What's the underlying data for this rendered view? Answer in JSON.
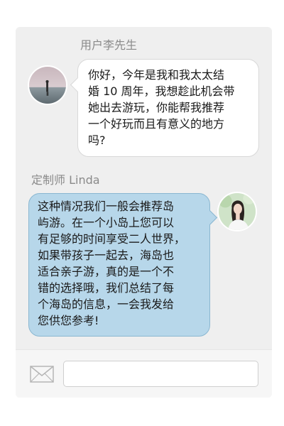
{
  "conversation": {
    "user": {
      "name": "用户李先生",
      "avatar_icon": "person-on-beach-icon",
      "message": "你好，今年是我和我太太结\n婚 10 周年，我想趁此机会带\n她出去游玩，你能帮我推荐\n一个好玩而且有意义的地方\n吗?"
    },
    "advisor": {
      "name": "定制师 Linda",
      "avatar_icon": "woman-portrait-icon",
      "message": "这种情况我们一般会推荐岛\n屿游。在一个小岛上您可以\n有足够的时间享受二人世界，\n如果带孩子一起去，海岛也\n适合亲子游，真的是一个不\n错的选择哦，我们总结了每\n个海岛的信息，一会我发给\n您供您参考!"
    }
  },
  "composer": {
    "icon": "mail-icon",
    "input_value": ""
  },
  "colors": {
    "panel_bg": "#efefef",
    "user_bubble": "#ffffff",
    "advisor_bubble": "#b7d7ea",
    "advisor_bubble_border": "#8ab7d1",
    "name_text": "#8a8a8a"
  }
}
